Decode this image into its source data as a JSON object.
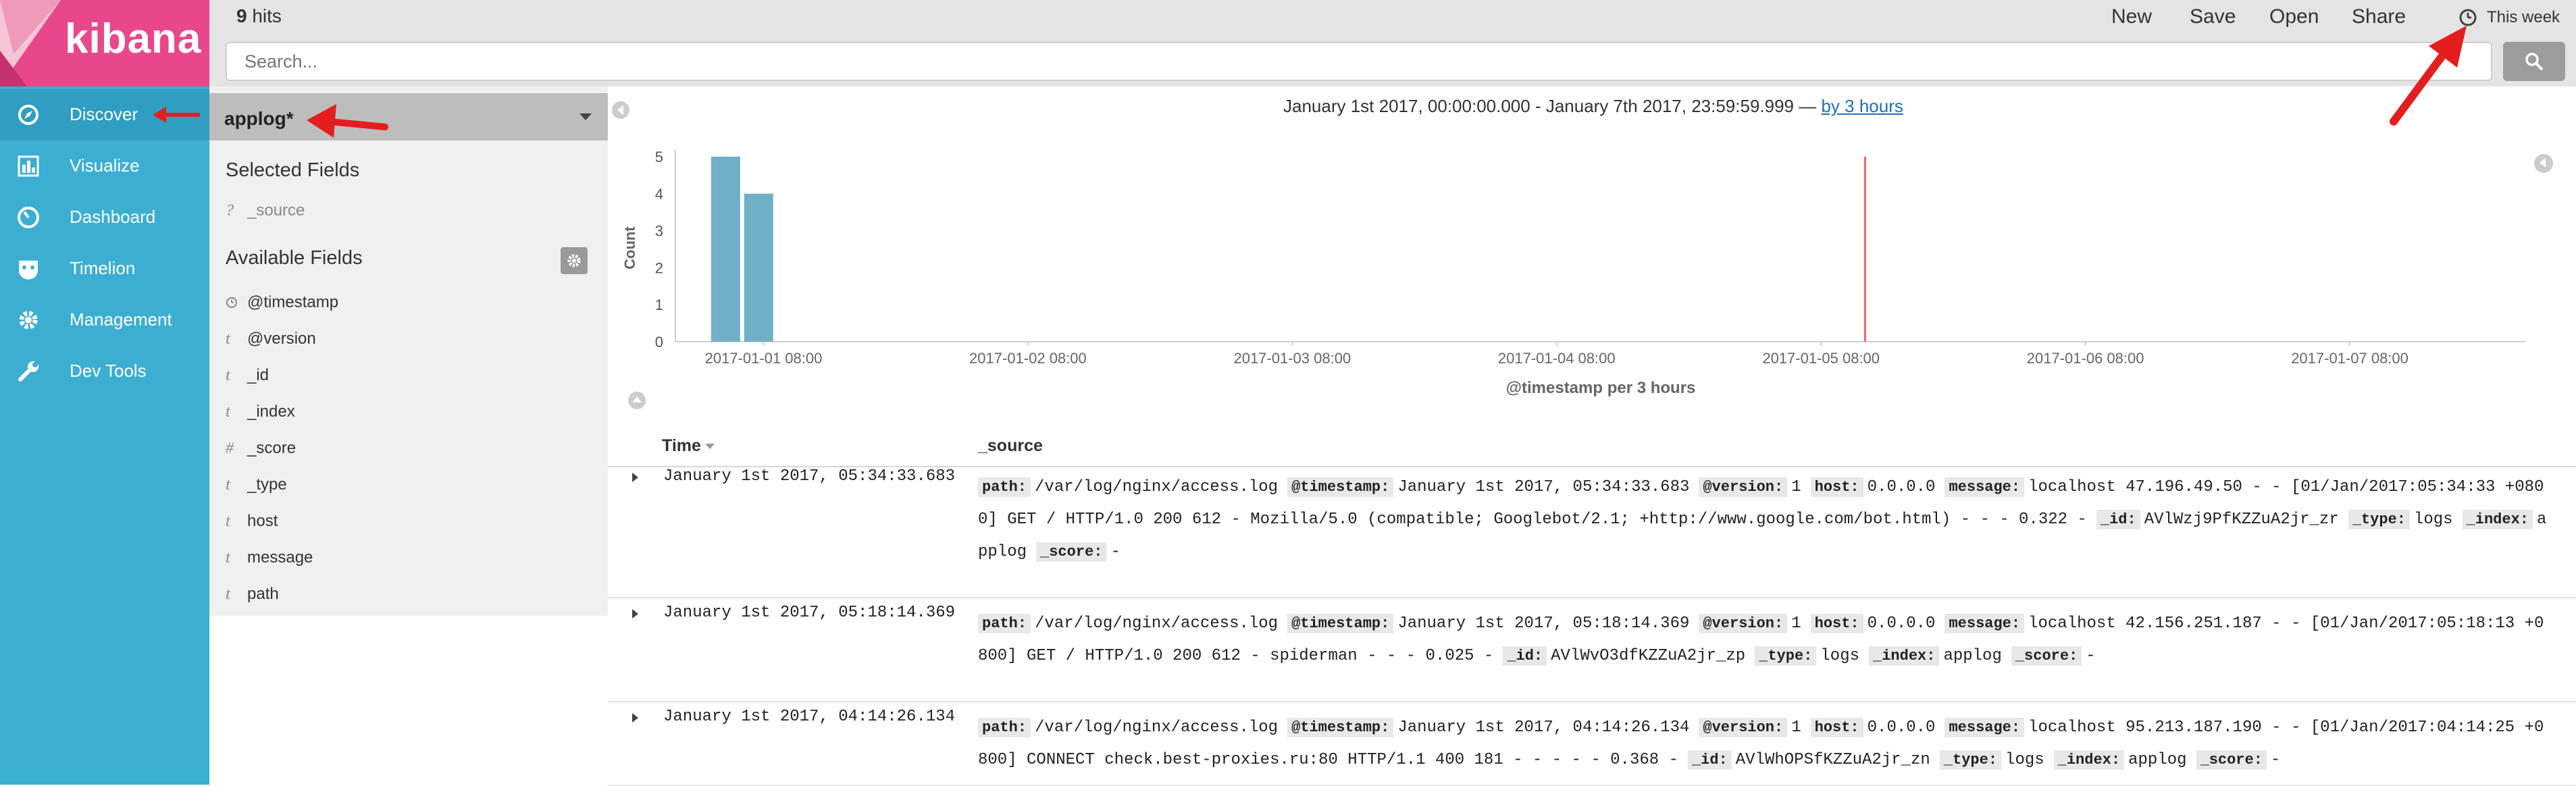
{
  "app": {
    "logo_text": "kibana"
  },
  "nav": {
    "items": [
      {
        "label": "Discover",
        "icon": "compass-icon",
        "active": true
      },
      {
        "label": "Visualize",
        "icon": "bar-chart-icon"
      },
      {
        "label": "Dashboard",
        "icon": "dashboard-gauge-icon"
      },
      {
        "label": "Timelion",
        "icon": "timelion-mask-icon"
      },
      {
        "label": "Management",
        "icon": "gear-icon"
      },
      {
        "label": "Dev Tools",
        "icon": "wrench-icon"
      }
    ]
  },
  "topbar": {
    "hits_count": "9",
    "hits_label": "hits",
    "links": [
      "New",
      "Save",
      "Open",
      "Share"
    ],
    "time_label": "This week",
    "search_placeholder": "Search..."
  },
  "sidebar": {
    "index_pattern": "applog*",
    "selected_title": "Selected Fields",
    "selected_fields": [
      {
        "type": "?",
        "name": "_source"
      }
    ],
    "available_title": "Available Fields",
    "available_fields": [
      {
        "type": "clock",
        "name": "@timestamp"
      },
      {
        "type": "t",
        "name": "@version"
      },
      {
        "type": "t",
        "name": "_id"
      },
      {
        "type": "t",
        "name": "_index"
      },
      {
        "type": "#",
        "name": "_score"
      },
      {
        "type": "t",
        "name": "_type"
      },
      {
        "type": "t",
        "name": "host"
      },
      {
        "type": "t",
        "name": "message"
      },
      {
        "type": "t",
        "name": "path"
      }
    ]
  },
  "histogram": {
    "range_text": "January 1st 2017, 00:00:00.000 - January 7th 2017, 23:59:59.999 — ",
    "interval_link": "by 3 hours",
    "colors": {
      "bar": "#6fb0c8",
      "now_line": "#e8686a"
    }
  },
  "chart_data": {
    "type": "bar",
    "xlabel": "@timestamp per 3 hours",
    "ylabel": "Count",
    "ylim": [
      0,
      5
    ],
    "yticks": [
      0,
      1,
      2,
      3,
      4,
      5
    ],
    "x_range": [
      "2017-01-01 00:00",
      "2017-01-07 23:59:59"
    ],
    "x_tick_labels": [
      "2017-01-01 08:00",
      "2017-01-02 08:00",
      "2017-01-03 08:00",
      "2017-01-04 08:00",
      "2017-01-05 08:00",
      "2017-01-06 08:00",
      "2017-01-07 08:00"
    ],
    "bars": [
      {
        "x": "2017-01-01 03:00",
        "value": 5
      },
      {
        "x": "2017-01-01 06:00",
        "value": 4
      }
    ],
    "marker_line_x": "2017-01-05 12:00"
  },
  "table": {
    "col_time": "Time",
    "col_source": "_source",
    "rows": [
      {
        "time": "January 1st 2017, 05:34:33.683",
        "fields": [
          {
            "k": "path:",
            "v": "/var/log/nginx/access.log"
          },
          {
            "k": "@timestamp:",
            "v": "January 1st 2017, 05:34:33.683"
          },
          {
            "k": "@version:",
            "v": "1"
          },
          {
            "k": "host:",
            "v": "0.0.0.0"
          },
          {
            "k": "message:",
            "v": "localhost 47.196.49.50 - - [01/Jan/2017:05:34:33 +0800] GET / HTTP/1.0 200 612 - Mozilla/5.0 (compatible; Googlebot/2.1; +http://www.google.com/bot.html) - - - 0.322 -"
          },
          {
            "k": "_id:",
            "v": "AVlWzj9PfKZZuA2jr_zr"
          },
          {
            "k": "_type:",
            "v": "logs"
          },
          {
            "k": "_index:",
            "v": "applog"
          },
          {
            "k": "_score:",
            "v": "-"
          }
        ]
      },
      {
        "time": "January 1st 2017, 05:18:14.369",
        "fields": [
          {
            "k": "path:",
            "v": "/var/log/nginx/access.log"
          },
          {
            "k": "@timestamp:",
            "v": "January 1st 2017, 05:18:14.369"
          },
          {
            "k": "@version:",
            "v": "1"
          },
          {
            "k": "host:",
            "v": "0.0.0.0"
          },
          {
            "k": "message:",
            "v": "localhost 42.156.251.187 - - [01/Jan/2017:05:18:13 +0800] GET / HTTP/1.0 200 612 - spiderman - - - 0.025 -"
          },
          {
            "k": "_id:",
            "v": "AVlWvO3dfKZZuA2jr_zp"
          },
          {
            "k": "_type:",
            "v": "logs"
          },
          {
            "k": "_index:",
            "v": "applog"
          },
          {
            "k": "_score:",
            "v": "-"
          }
        ]
      },
      {
        "time": "January 1st 2017, 04:14:26.134",
        "fields": [
          {
            "k": "path:",
            "v": "/var/log/nginx/access.log"
          },
          {
            "k": "@timestamp:",
            "v": "January 1st 2017, 04:14:26.134"
          },
          {
            "k": "@version:",
            "v": "1"
          },
          {
            "k": "host:",
            "v": "0.0.0.0"
          },
          {
            "k": "message:",
            "v": "localhost 95.213.187.190 - - [01/Jan/2017:04:14:25 +0800] CONNECT check.best-proxies.ru:80 HTTP/1.1 400 181 - - - - - 0.368 -"
          },
          {
            "k": "_id:",
            "v": "AVlWhOPSfKZZuA2jr_zn"
          },
          {
            "k": "_type:",
            "v": "logs"
          },
          {
            "k": "_index:",
            "v": "applog"
          },
          {
            "k": "_score:",
            "v": "-"
          }
        ]
      }
    ]
  }
}
